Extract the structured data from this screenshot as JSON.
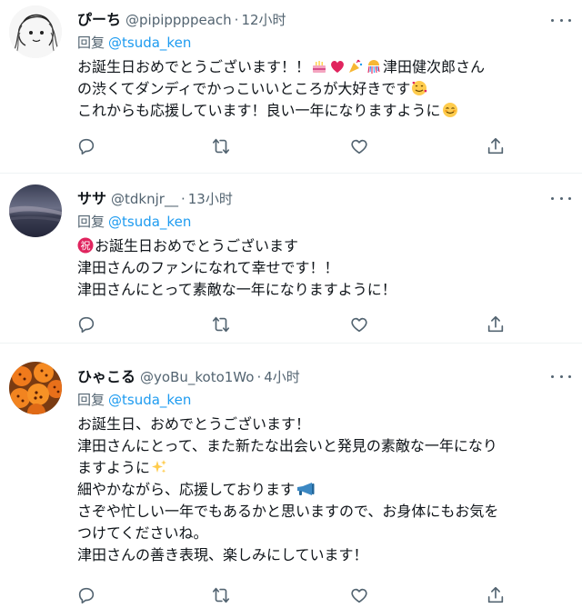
{
  "tweets": [
    {
      "name": "ぴーち",
      "handle": "@pipippppeach",
      "separator": "·",
      "time": "12小时",
      "reply_prefix": "回复",
      "reply_to": "@tsuda_ken",
      "lines": [
        "お誕生日おめでとうございます！！",
        "津田健次郎さん",
        "の渋くてダンディでかっこいいところが大好きです",
        "これからも応援しています！良い一年になりますように"
      ],
      "emojis": [
        "birthday-cake",
        "red-heart",
        "party-popper",
        "confetti-ball",
        "smiling-face-with-hearts",
        "smiling-face-blushing"
      ]
    },
    {
      "name": "ササ",
      "handle": "@tdknjr__",
      "separator": "·",
      "time": "13小时",
      "reply_prefix": "回复",
      "reply_to": "@tsuda_ken",
      "lines": [
        "お誕生日おめでとうございます",
        "津田さんのファンになれて幸せです！！",
        "津田さんにとって素敵な一年になりますように！"
      ],
      "emojis": [
        "congratulations-ideograph"
      ],
      "emoji_text": "祝"
    },
    {
      "name": "ひゃこる",
      "handle": "@yoBu_koto1Wo",
      "separator": "·",
      "time": "4小时",
      "reply_prefix": "回复",
      "reply_to": "@tsuda_ken",
      "lines": [
        "お誕生日、おめでとうございます！",
        "津田さんにとって、また新たな出会いと発見の素敵な一年になり",
        "ますように",
        "細やかながら、応援しております",
        "さぞや忙しい一年でもあるかと思いますので、お身体にもお気を",
        "つけてくださいね。",
        "津田さんの善き表現、楽しみにしています！"
      ],
      "emojis": [
        "sparkles",
        "megaphone"
      ]
    }
  ],
  "actions": [
    "reply-icon",
    "retweet-icon",
    "like-icon",
    "share-icon"
  ],
  "colors": {
    "text": "#0f1419",
    "secondary": "#536471",
    "link": "#1d9bf0",
    "divider": "#eff3f4"
  }
}
